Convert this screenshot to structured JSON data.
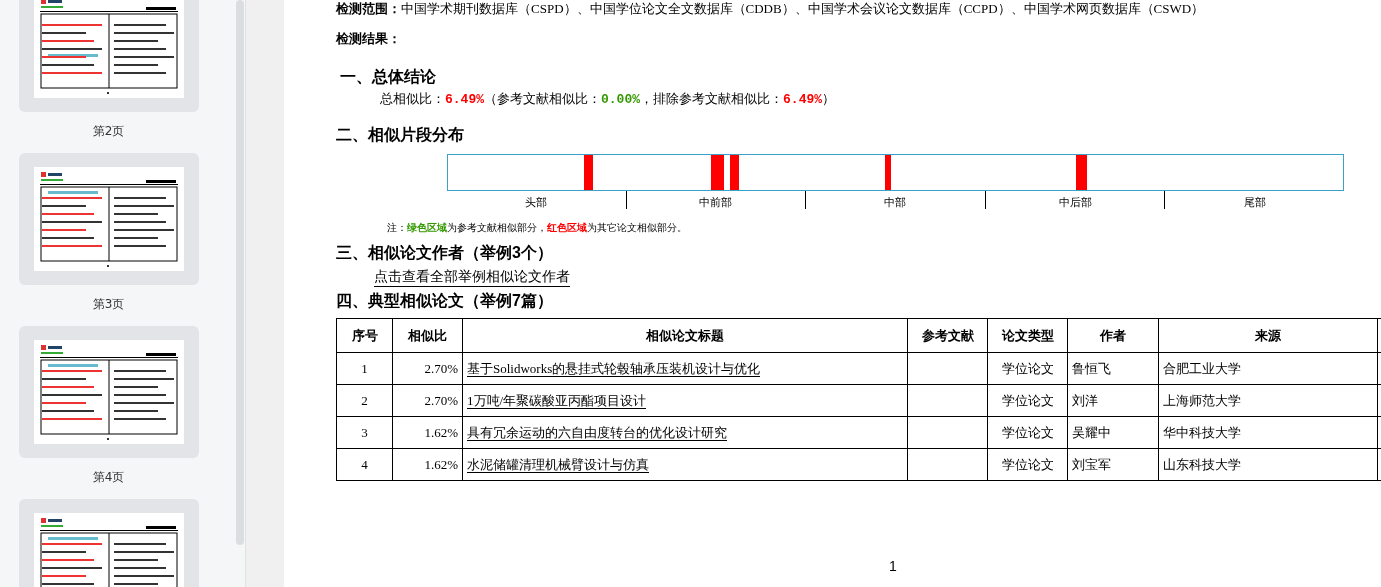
{
  "sidebar": {
    "pages": [
      {
        "label": "第2页"
      },
      {
        "label": "第3页"
      },
      {
        "label": "第4页"
      }
    ],
    "next_page_partial": true
  },
  "scope": {
    "label": "检测范围：",
    "text": "中国学术期刊数据库（CSPD）、中国学位论文全文数据库（CDDB）、中国学术会议论文数据库（CCPD）、中国学术网页数据库（CSWD）"
  },
  "result_label": "检测结果：",
  "conclusion": {
    "heading": "一、总体结论",
    "parts": [
      {
        "text": "总相似比："
      },
      {
        "text": "6.49%",
        "color": "#ff0000"
      },
      {
        "text": "（参考文献相似比："
      },
      {
        "text": "0.00%",
        "color": "#339900"
      },
      {
        "text": "，排除参考文献相似比："
      },
      {
        "text": "6.49%",
        "color": "#ff0000"
      },
      {
        "text": "）"
      }
    ]
  },
  "distribution": {
    "heading": "二、相似片段分布",
    "zones": [
      "头部",
      "中前部",
      "中部",
      "中后部",
      "尾部"
    ],
    "note": [
      {
        "text": "注："
      },
      {
        "text": "绿色区域",
        "color": "#339900"
      },
      {
        "text": "为参考文献相似部分，"
      },
      {
        "text": "红色区域",
        "color": "#ff0000"
      },
      {
        "text": "为其它论文相似部分。"
      }
    ]
  },
  "authors": {
    "heading": "三、相似论文作者（举例3个）",
    "link": "点击查看全部举例相似论文作者"
  },
  "papers": {
    "heading": "四、典型相似论文（举例7篇）",
    "columns": [
      "序号",
      "相似比",
      "相似论文标题",
      "参考文献",
      "论文类型",
      "作者",
      "来源"
    ],
    "rows": [
      {
        "no": "1",
        "ratio": "2.70%",
        "title": "基于Solidworks的悬挂式轮毂轴承压装机设计与优化",
        "type": "学位论文",
        "author": "鲁恒飞",
        "source": "合肥工业大学"
      },
      {
        "no": "2",
        "ratio": "2.70%",
        "title": "1万吨/年聚碳酸亚丙酯项目设计",
        "type": "学位论文",
        "author": "刘洋",
        "source": "上海师范大学"
      },
      {
        "no": "3",
        "ratio": "1.62%",
        "title": "具有冗余运动的六自由度转台的优化设计研究",
        "type": "学位论文",
        "author": "吴耀中",
        "source": "华中科技大学"
      },
      {
        "no": "4",
        "ratio": "1.62%",
        "title": "水泥储罐清理机械臂设计与仿真",
        "type": "学位论文",
        "author": "刘宝军",
        "source": "山东科技大学"
      }
    ]
  },
  "page_number": "1"
}
